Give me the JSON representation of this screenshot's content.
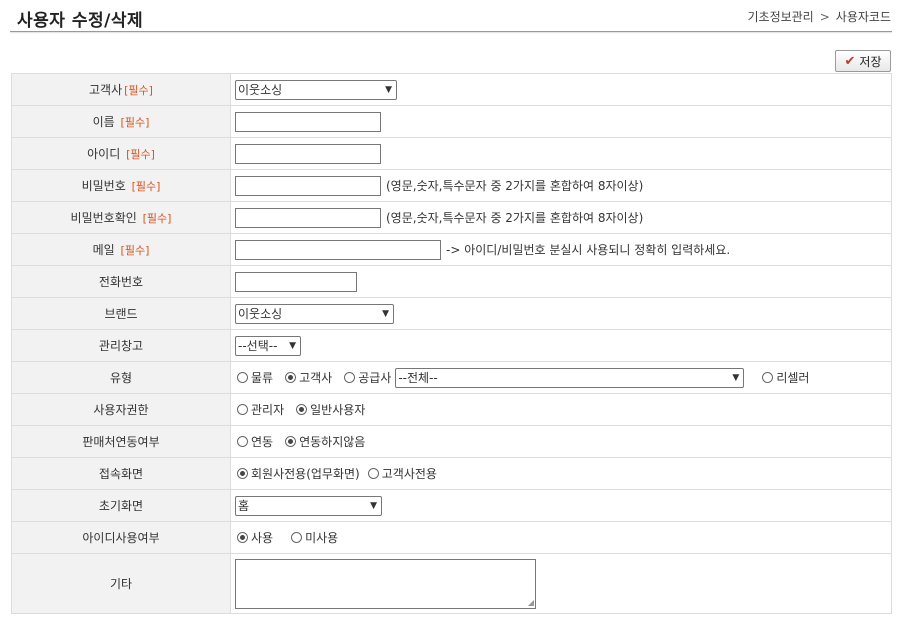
{
  "header": {
    "title": "사용자 수정/삭제",
    "breadcrumb": [
      "기초정보관리",
      "사용자코드"
    ],
    "breadcrumb_sep": ">"
  },
  "toolbar": {
    "save_label": "저장",
    "save_icon": "check-icon"
  },
  "required_tag": "[필수]",
  "form": {
    "customer": {
      "label": "고객사",
      "value": "이웃소싱"
    },
    "name": {
      "label": "이름",
      "value": ""
    },
    "user_id": {
      "label": "아이디",
      "value": ""
    },
    "password": {
      "label": "비밀번호",
      "value": "",
      "hint": "(영문,숫자,특수문자 중 2가지를 혼합하여 8자이상)"
    },
    "password_confirm": {
      "label": "비밀번호확인",
      "value": "",
      "hint": "(영문,숫자,특수문자 중 2가지를 혼합하여 8자이상)"
    },
    "email": {
      "label": "메일",
      "value": "",
      "hint": "-> 아이디/비밀번호 분실시 사용되니 정확히 입력하세요."
    },
    "phone": {
      "label": "전화번호",
      "value": ""
    },
    "brand": {
      "label": "브랜드",
      "value": "이웃소싱"
    },
    "warehouse": {
      "label": "관리창고",
      "value": "--선택--"
    },
    "type": {
      "label": "유형",
      "options": [
        "물류",
        "고객사",
        "공급사"
      ],
      "selected": "고객사",
      "supplier_select": "--전체--",
      "reseller": "리셀러"
    },
    "permission": {
      "label": "사용자권한",
      "options": [
        "관리자",
        "일반사용자"
      ],
      "selected": "일반사용자"
    },
    "seller_link": {
      "label": "판매처연동여부",
      "options": [
        "연동",
        "연동하지않음"
      ],
      "selected": "연동하지않음"
    },
    "access_screen": {
      "label": "접속화면",
      "options": [
        "회원사전용(업무화면)",
        "고객사전용"
      ],
      "selected": "회원사전용(업무화면)"
    },
    "initial_screen": {
      "label": "초기화면",
      "value": "홈"
    },
    "id_usage": {
      "label": "아이디사용여부",
      "options": [
        "사용",
        "미사용"
      ],
      "selected": "사용"
    },
    "etc": {
      "label": "기타",
      "value": ""
    }
  }
}
